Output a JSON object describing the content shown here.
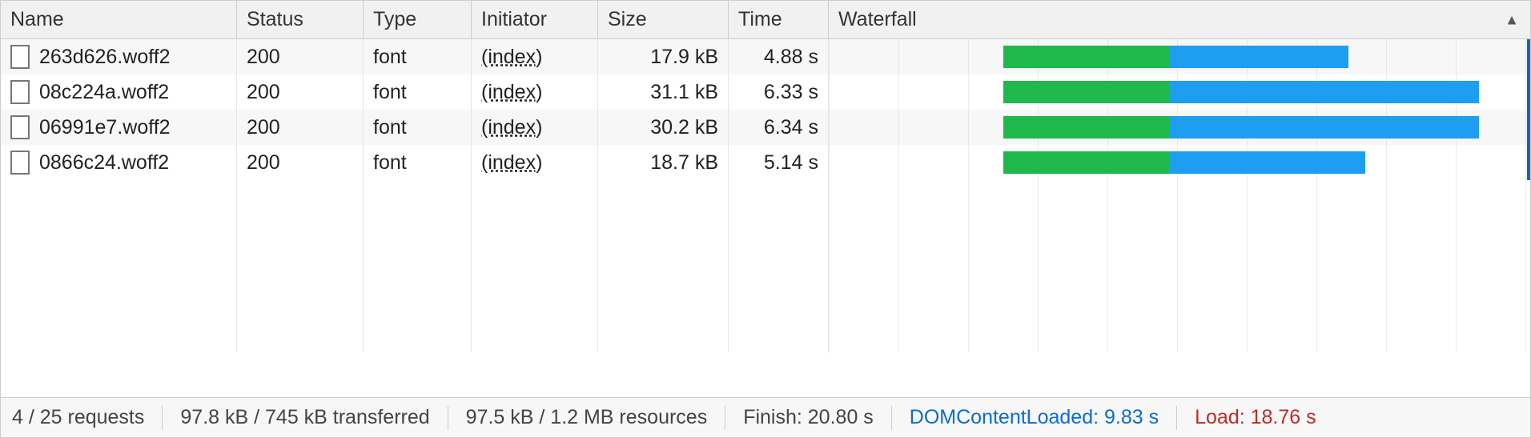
{
  "columns": {
    "name": "Name",
    "status": "Status",
    "type": "Type",
    "initiator": "Initiator",
    "size": "Size",
    "time": "Time",
    "waterfall": "Waterfall"
  },
  "sort_column": "waterfall",
  "sort_direction": "asc",
  "waterfall": {
    "total_seconds": 8.0,
    "timeline_right_marker": true
  },
  "rows": [
    {
      "name": "263d626.woff2",
      "status": "200",
      "type": "font",
      "initiator": "(index)",
      "size": "17.9 kB",
      "time": "4.88 s",
      "bar": {
        "start_s": 2.0,
        "wait_s": 1.9,
        "dl_s": 2.05
      }
    },
    {
      "name": "08c224a.woff2",
      "status": "200",
      "type": "font",
      "initiator": "(index)",
      "size": "31.1 kB",
      "time": "6.33 s",
      "bar": {
        "start_s": 2.0,
        "wait_s": 1.9,
        "dl_s": 3.55
      }
    },
    {
      "name": "06991e7.woff2",
      "status": "200",
      "type": "font",
      "initiator": "(index)",
      "size": "30.2 kB",
      "time": "6.34 s",
      "bar": {
        "start_s": 2.0,
        "wait_s": 1.9,
        "dl_s": 3.55
      }
    },
    {
      "name": "0866c24.woff2",
      "status": "200",
      "type": "font",
      "initiator": "(index)",
      "size": "18.7 kB",
      "time": "5.14 s",
      "bar": {
        "start_s": 2.0,
        "wait_s": 1.9,
        "dl_s": 2.25
      }
    }
  ],
  "status_bar": {
    "requests": "4 / 25 requests",
    "transferred": "97.8 kB / 745 kB transferred",
    "resources": "97.5 kB / 1.2 MB resources",
    "finish": "Finish: 20.80 s",
    "dcl": "DOMContentLoaded: 9.83 s",
    "load": "Load: 18.76 s"
  }
}
